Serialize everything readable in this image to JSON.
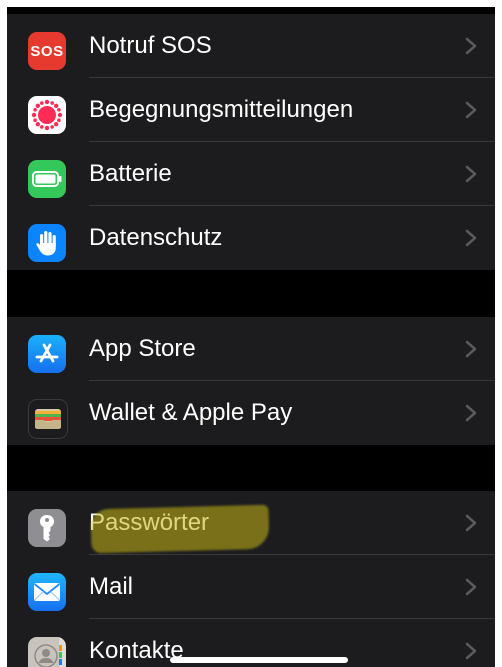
{
  "colors": {
    "background": "#000000",
    "group_background": "#1c1c1e",
    "separator": "#38383a",
    "chevron": "#5a5a5e",
    "highlight": "#c4b414"
  },
  "groups": [
    {
      "items": [
        {
          "label": "Notruf SOS",
          "icon": "sos-icon",
          "icon_text": "SOS",
          "icon_color": "#e63a2e"
        },
        {
          "label": "Begegnungsmitteilungen",
          "icon": "exposure-notification-icon",
          "icon_color": "#ffffff"
        },
        {
          "label": "Batterie",
          "icon": "battery-icon",
          "icon_color": "#34c759"
        },
        {
          "label": "Datenschutz",
          "icon": "hand-icon",
          "icon_color": "#0a84ff"
        }
      ]
    },
    {
      "items": [
        {
          "label": "App Store",
          "icon": "app-store-icon",
          "icon_color": "#1e8ef5"
        },
        {
          "label": "Wallet & Apple Pay",
          "icon": "wallet-icon",
          "icon_color": "#1c1c1e"
        }
      ]
    },
    {
      "items": [
        {
          "label": "Passwörter",
          "icon": "key-icon",
          "icon_color": "#8e8e93"
        },
        {
          "label": "Mail",
          "icon": "mail-icon",
          "icon_color": "#1a8cff"
        },
        {
          "label": "Kontakte",
          "icon": "contacts-icon",
          "icon_color": "#c8c4bd"
        }
      ]
    }
  ]
}
